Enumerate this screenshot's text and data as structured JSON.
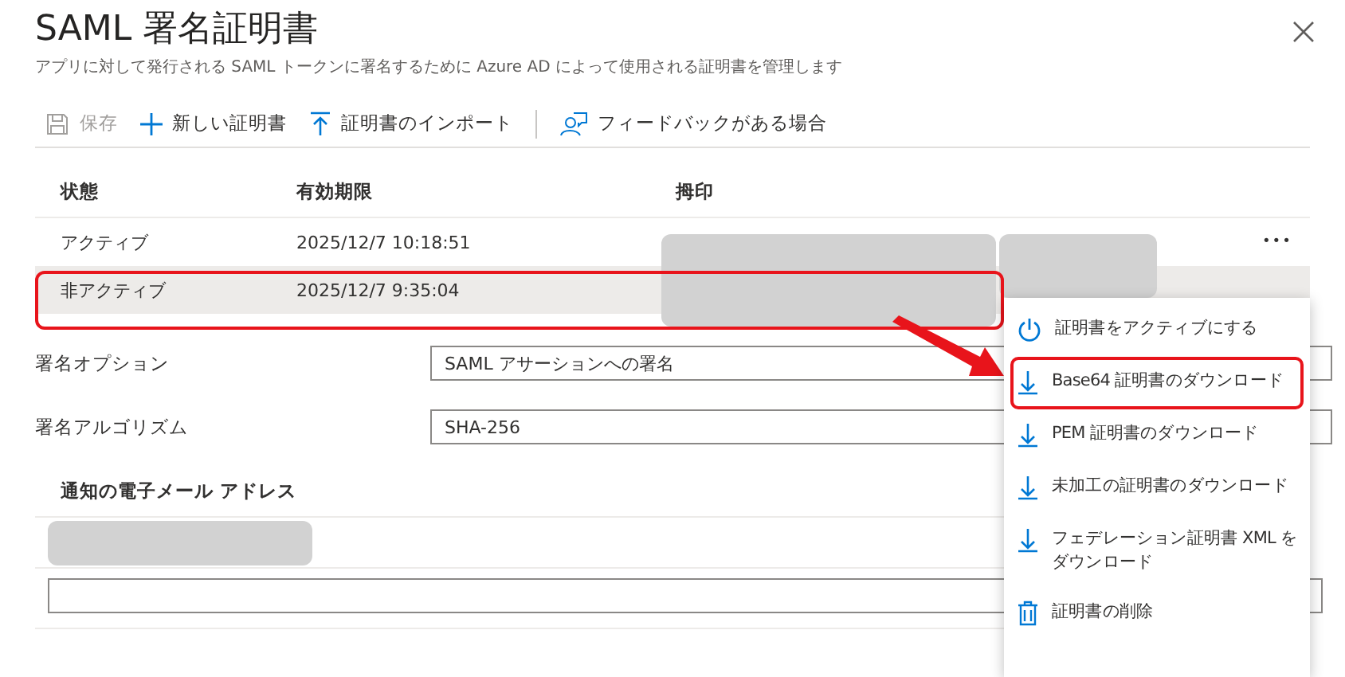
{
  "title": "SAML 署名証明書",
  "subtitle": "アプリに対して発行される SAML トークンに署名するために Azure AD によって使用される証明書を管理します",
  "toolbar": [
    {
      "kind": "save",
      "label": "保存",
      "disabled": true
    },
    {
      "kind": "plus",
      "label": "新しい証明書",
      "disabled": false
    },
    {
      "kind": "upload",
      "label": "証明書のインポート",
      "disabled": false
    },
    {
      "kind": "feedback",
      "label": "フィードバックがある場合",
      "disabled": false
    }
  ],
  "table": {
    "columns": [
      "状態",
      "有効期限",
      "拇印"
    ],
    "rows": [
      {
        "status": "アクティブ",
        "expiry": "2025/12/7 10:18:51",
        "selected": false,
        "highlighted": false,
        "more": "•••"
      },
      {
        "status": "非アクティブ",
        "expiry": "2025/12/7 9:35:04",
        "selected": true,
        "highlighted": true
      }
    ]
  },
  "options": [
    {
      "label": "署名オプション",
      "value": "SAML アサーションへの署名"
    },
    {
      "label": "署名アルゴリズム",
      "value": "SHA-256"
    }
  ],
  "email": {
    "heading": "通知の電子メール アドレス"
  },
  "menu": [
    {
      "kind": "power",
      "label": "証明書をアクティブにする",
      "highlighted": false
    },
    {
      "kind": "download",
      "label": "Base64 証明書のダウンロード",
      "highlighted": true
    },
    {
      "kind": "download",
      "label": "PEM 証明書のダウンロード",
      "highlighted": false
    },
    {
      "kind": "download",
      "label": "未加工の証明書のダウンロード",
      "highlighted": false
    },
    {
      "kind": "download",
      "label": "フェデレーション証明書 XML をダウンロード",
      "highlighted": false
    },
    {
      "kind": "trash",
      "label": "証明書の削除",
      "highlighted": false
    }
  ]
}
